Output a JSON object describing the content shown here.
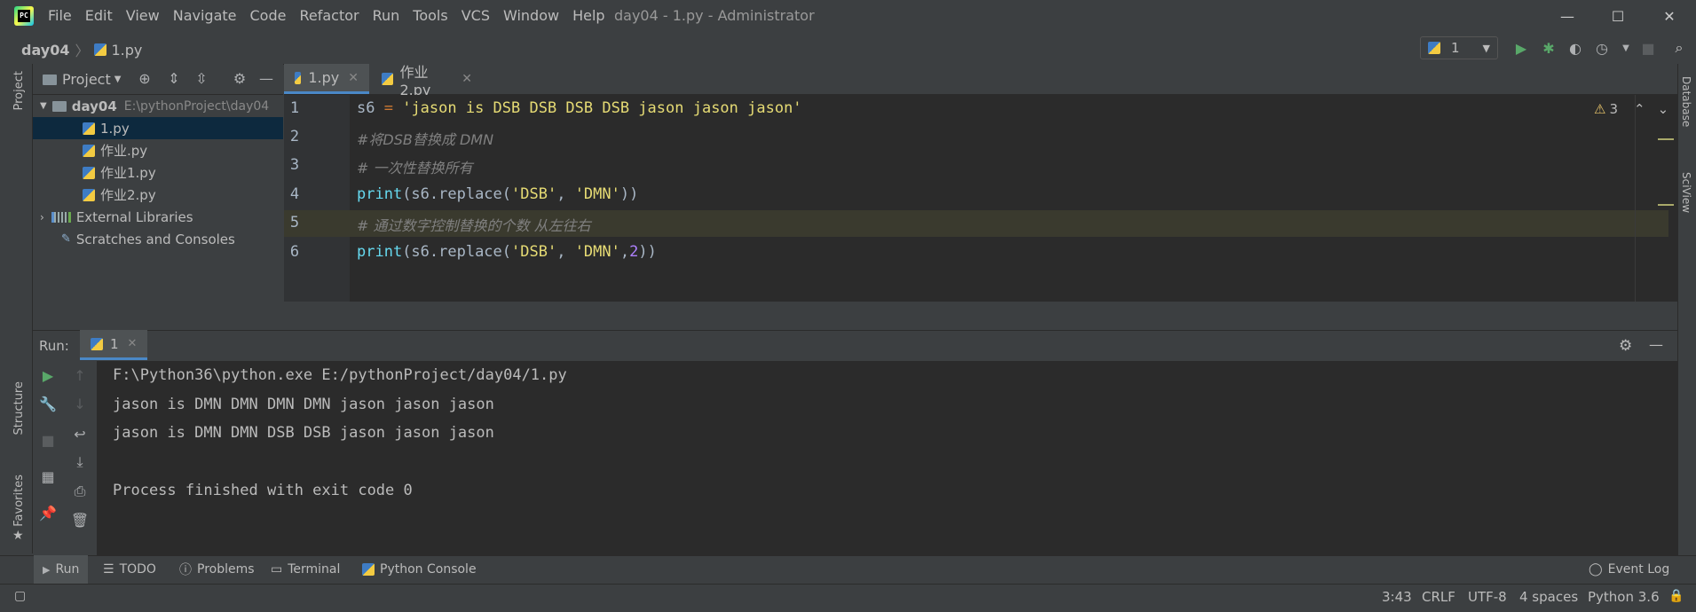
{
  "window": {
    "title": "day04 - 1.py - Administrator",
    "menu": [
      "File",
      "Edit",
      "View",
      "Navigate",
      "Code",
      "Refactor",
      "Run",
      "Tools",
      "VCS",
      "Window",
      "Help"
    ],
    "minimize": "—",
    "maximize": "☐",
    "close": "✕"
  },
  "navbar": {
    "project": "day04",
    "file": "1.py",
    "run_config": "1"
  },
  "project_panel": {
    "title": "Project",
    "root_name": "day04",
    "root_path": "E:\\pythonProject\\day04",
    "files": [
      "1.py",
      "作业.py",
      "作业1.py",
      "作业2.py"
    ],
    "external": "External Libraries",
    "scratches": "Scratches and Consoles"
  },
  "editor": {
    "tabs": [
      "1.py",
      "作业2.py"
    ],
    "warnings": "3",
    "line_numbers": [
      "1",
      "2",
      "3",
      "4",
      "5",
      "6"
    ],
    "lines": {
      "l1_var": "s6",
      "l1_eq": " = ",
      "l1_str": "'jason is DSB DSB DSB DSB jason jason jason'",
      "l2": "#将DSB替换成 DMN",
      "l3": "# 一次性替换所有",
      "l4_fn": "print",
      "l4_rest": "(s6.replace(",
      "l4_a": "'DSB'",
      "l4_comma": ", ",
      "l4_b": "'DMN'",
      "l4_end": "))",
      "l5": "# 通过数字控制替换的个数 从左往右",
      "l6_fn": "print",
      "l6_rest": "(s6.replace(",
      "l6_a": "'DSB'",
      "l6_comma": ", ",
      "l6_b": "'DMN'",
      "l6_sep": ",",
      "l6_num": "2",
      "l6_end": "))"
    }
  },
  "run_panel": {
    "label": "Run:",
    "tab": "1",
    "output": [
      "F:\\Python36\\python.exe E:/pythonProject/day04/1.py",
      "jason is DMN DMN DMN DMN jason jason jason",
      "jason is DMN DMN DSB DSB jason jason jason",
      "",
      "Process finished with exit code 0"
    ]
  },
  "side_labels": {
    "project": "Project",
    "structure": "Structure",
    "favorites": "Favorites",
    "database": "Database",
    "sciview": "SciView"
  },
  "bottom_tabs": [
    "Run",
    "TODO",
    "Problems",
    "Terminal",
    "Python Console"
  ],
  "event_log": "Event Log",
  "status": {
    "position": "3:43",
    "line_sep": "CRLF",
    "encoding": "UTF-8",
    "indent": "4 spaces",
    "interpreter": "Python 3.6"
  },
  "colors": {
    "accent": "#4a88c7",
    "bg_editor": "#2b2b2b",
    "bg_panel": "#3c3f41"
  }
}
